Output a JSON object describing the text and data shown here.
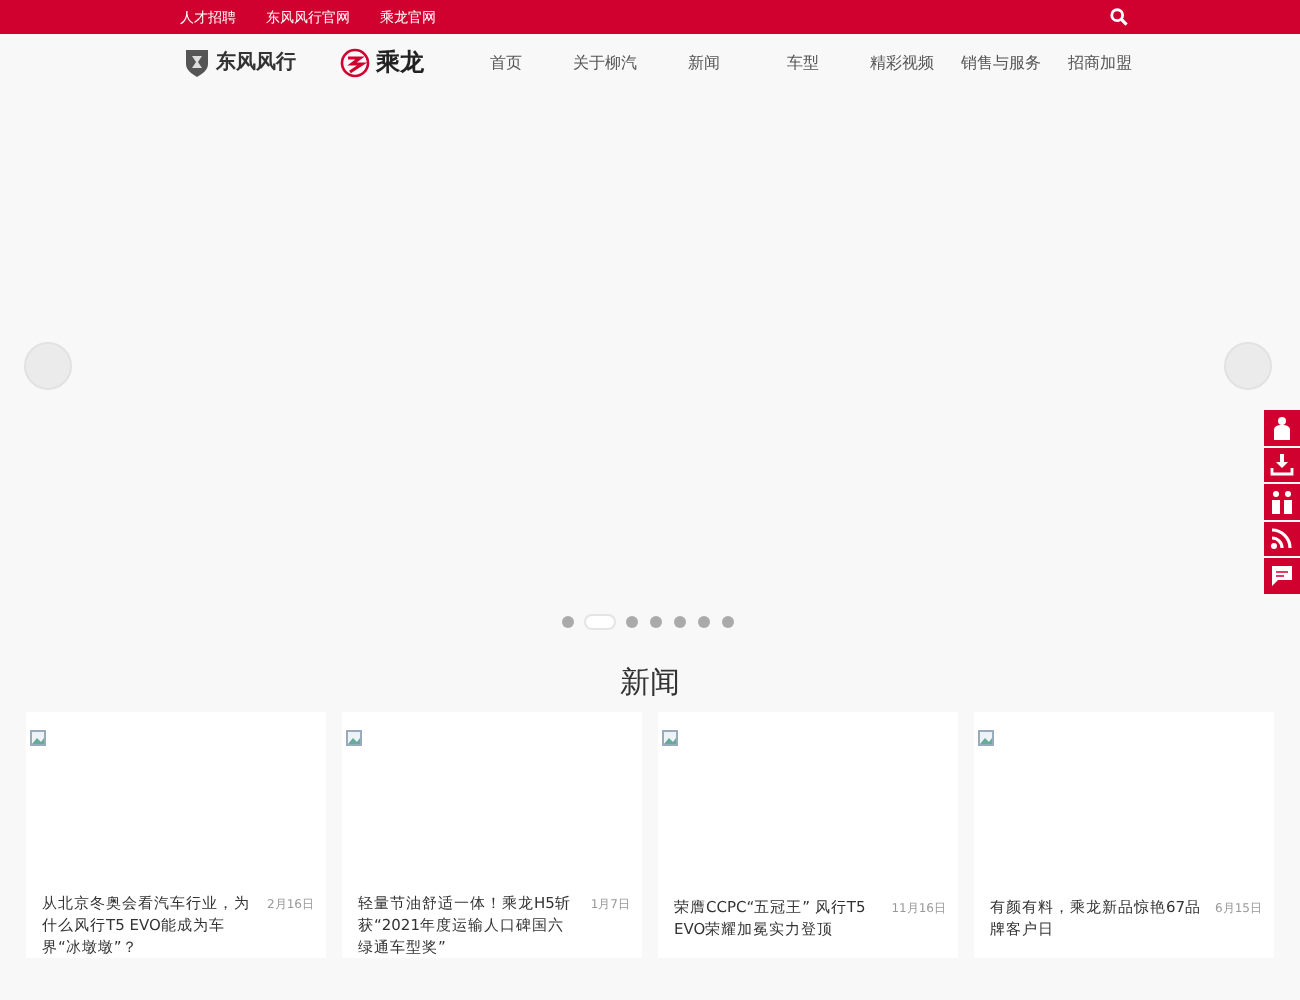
{
  "top_bar": {
    "links": [
      "人才招聘",
      "东风风行官网",
      "乘龙官网"
    ]
  },
  "header": {
    "logos": [
      {
        "kind": "dongfeng",
        "text": "东风风行"
      },
      {
        "kind": "chenglong",
        "text": "乘龙"
      }
    ],
    "nav": [
      "首页",
      "关于柳汽",
      "新闻",
      "车型",
      "精彩视频",
      "销售与服务",
      "招商加盟"
    ]
  },
  "carousel": {
    "dots": [
      {
        "selected": false
      },
      {
        "selected": true
      },
      {
        "selected": false
      },
      {
        "selected": false
      },
      {
        "selected": false
      },
      {
        "selected": false
      },
      {
        "selected": false
      }
    ]
  },
  "side_tools": [
    {
      "kind": "person"
    },
    {
      "kind": "download"
    },
    {
      "kind": "people"
    },
    {
      "kind": "rss"
    },
    {
      "kind": "message"
    }
  ],
  "news": {
    "title": "新闻",
    "cards": [
      {
        "title": "从北京冬奥会看汽车行业，为什么风行T5 EVO能成为车界“冰墩墩”？",
        "date": "2月16日"
      },
      {
        "title": "轻量节油舒适一体！乘龙H5斩获“2021年度运输人口碑国六绿通车型奖”",
        "date": "1月7日"
      },
      {
        "title": "荣膺CCPC“五冠王” 风行T5 EVO荣耀加冕实力登顶",
        "date": "11月16日"
      },
      {
        "title": "有颜有料，乘龙新品惊艳67品牌客户日",
        "date": "6月15日"
      }
    ]
  }
}
